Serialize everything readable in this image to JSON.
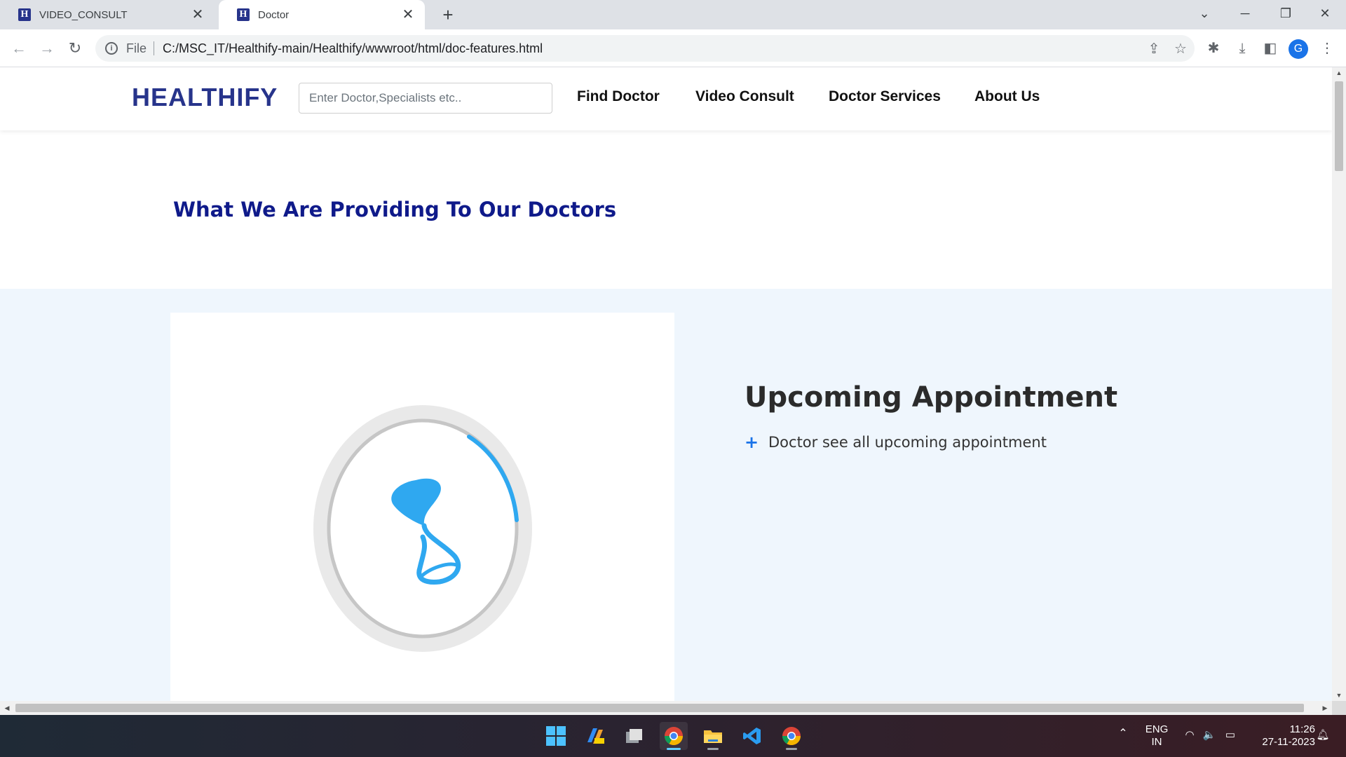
{
  "browser": {
    "tabs": [
      {
        "favicon": "H",
        "title": "VIDEO_CONSULT",
        "active": false
      },
      {
        "favicon": "H",
        "title": "Doctor",
        "active": true
      }
    ],
    "address": {
      "scheme": "File",
      "url": "C:/MSC_IT/Healthify-main/Healthify/wwwroot/html/doc-features.html"
    },
    "profile_initial": "G"
  },
  "site": {
    "logo": "HEALTHIFY",
    "search_placeholder": "Enter Doctor,Specialists etc..",
    "nav": [
      "Find Doctor",
      "Video Consult",
      "Doctor Services",
      "About Us"
    ],
    "section_title": "What We Are Providing To Our Doctors",
    "feature": {
      "heading": "Upcoming Appointment",
      "items": [
        "Doctor see all upcoming appointment"
      ]
    }
  },
  "taskbar": {
    "language": [
      "ENG",
      "IN"
    ],
    "time": "11:26",
    "date": "27-11-2023"
  },
  "colors": {
    "brand": "#27348b",
    "section_title": "#0f1a8a",
    "feature_bg": "#eff6fd",
    "accent": "#2fa8f0"
  }
}
